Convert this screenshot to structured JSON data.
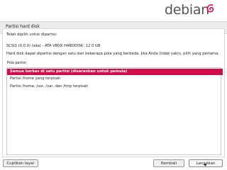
{
  "header": {
    "brand": "debian",
    "logo_icon": "debian-swirl-icon",
    "accent": "#d70a53"
  },
  "step": {
    "title": "Partisi hard disk"
  },
  "content": {
    "prompt": "Telah dipilih untuk dipartisi:",
    "disk": "SCSI1 (0,0,0) (sda) - ATA VBOX HARDDISK: 12.0 GB",
    "description": "Hard disk dapat dipartisi dengan satu dari beberapa pola yang berbeda. Jika Anda (tidak yakin, pilih yang pertama.",
    "list_label": "Pola partisi:"
  },
  "options": [
    {
      "label": "Semua berkas di satu partisi (disarankan untuk pemula)",
      "selected": true
    },
    {
      "label": "Partisi /home yang terpisah",
      "selected": false
    },
    {
      "label": "Partisi /home, /usr, /var, dan /tmp terpisah",
      "selected": false
    }
  ],
  "buttons": {
    "screenshot": "Cuplikan layar",
    "back": "Kembali",
    "continue": "Lanjutkan"
  }
}
